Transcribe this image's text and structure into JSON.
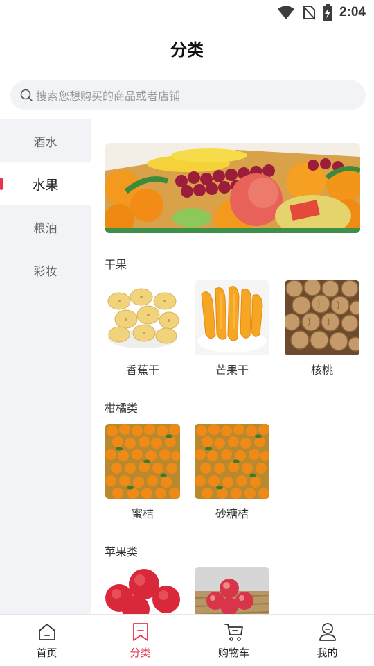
{
  "status_bar": {
    "time": "2:04",
    "icons": [
      "wifi-icon",
      "no-sim-icon",
      "battery-charging-icon"
    ]
  },
  "header": {
    "title": "分类"
  },
  "search": {
    "placeholder": "搜索您想购买的商品或者店铺",
    "icon": "search-icon"
  },
  "sidebar": {
    "items": [
      {
        "label": "酒水",
        "active": false
      },
      {
        "label": "水果",
        "active": true
      },
      {
        "label": "粮油",
        "active": false
      },
      {
        "label": "彩妆",
        "active": false
      }
    ]
  },
  "content": {
    "banner": "fruit-basket-banner",
    "sections": [
      {
        "title": "干果",
        "products": [
          {
            "name": "香蕉干",
            "image": "dried-banana-image"
          },
          {
            "name": "芒果干",
            "image": "dried-mango-image"
          },
          {
            "name": "核桃",
            "image": "walnut-image"
          }
        ]
      },
      {
        "title": "柑橘类",
        "products": [
          {
            "name": "蜜桔",
            "image": "tangerine-image"
          },
          {
            "name": "砂糖桔",
            "image": "sugar-orange-image"
          }
        ]
      },
      {
        "title": "苹果类",
        "products": [
          {
            "name": "",
            "image": "red-apple-image"
          },
          {
            "name": "",
            "image": "apple-basket-image"
          }
        ]
      }
    ]
  },
  "tabbar": {
    "tabs": [
      {
        "label": "首页",
        "icon": "home-icon",
        "active": false
      },
      {
        "label": "分类",
        "icon": "category-bookmark-icon",
        "active": true
      },
      {
        "label": "购物车",
        "icon": "cart-icon",
        "active": false
      },
      {
        "label": "我的",
        "icon": "profile-icon",
        "active": false
      }
    ]
  },
  "colors": {
    "accent": "#e8334a",
    "sidebar_bg": "#f2f3f6",
    "text": "#333333"
  }
}
